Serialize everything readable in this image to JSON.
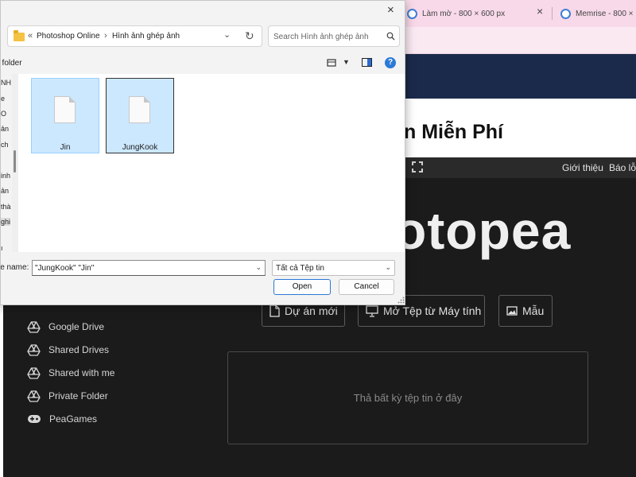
{
  "browser": {
    "tabs": [
      {
        "title": "Làm mờ - 800 × 600 px"
      },
      {
        "title": "Memrise - 800 ×"
      }
    ],
    "close_glyph": "×"
  },
  "website": {
    "title_fragment": "n Miễn Phí",
    "menu_links": [
      "Giới thiệu",
      "Báo lỗi"
    ],
    "logo_fragment": "otopea",
    "buttons": {
      "new_project": "Dự án mới",
      "open_from_computer": "Mở Tệp từ Máy tính",
      "templates": "Mẫu"
    },
    "sidebar_items": [
      {
        "label": "Google Drive",
        "icon": "drive-icon"
      },
      {
        "label": "Shared Drives",
        "icon": "drive-icon"
      },
      {
        "label": "Shared with me",
        "icon": "drive-icon"
      },
      {
        "label": "Private Folder",
        "icon": "drive-icon"
      },
      {
        "label": "PeaGames",
        "icon": "gamepad-icon"
      }
    ],
    "drop_zone_text": "Thả bất kỳ tệp tin ở đây"
  },
  "dialog": {
    "close_glyph": "×",
    "breadcrumb_overflow": "«",
    "breadcrumb": [
      "Photoshop Online",
      "Hình ảnh ghép ảnh"
    ],
    "breadcrumb_separator": "›",
    "search_placeholder": "Search Hình ảnh ghép ảnh",
    "command_bar_fragment": "/ folder",
    "help_glyph": "?",
    "nav_fragments": [
      "NH",
      "e",
      "O",
      "ản",
      "ch",
      "inh",
      "ản",
      "thà",
      "ghi",
      "ı"
    ],
    "files": [
      {
        "name": "Jin",
        "selected": true,
        "focused": false
      },
      {
        "name": "JungKook",
        "selected": true,
        "focused": true
      }
    ],
    "file_name_label": "le name:",
    "file_name_value": "\"JungKook\" \"Jin\"",
    "file_type_value": "Tất cả Tệp tin",
    "open_label": "Open",
    "cancel_label": "Cancel"
  },
  "colors": {
    "photopea_bg": "#1b1b1b",
    "site_nav": "#1b2a4a",
    "tabbar": "#f8d9e9",
    "selection": "#cce8ff",
    "accent": "#2b79d8"
  }
}
